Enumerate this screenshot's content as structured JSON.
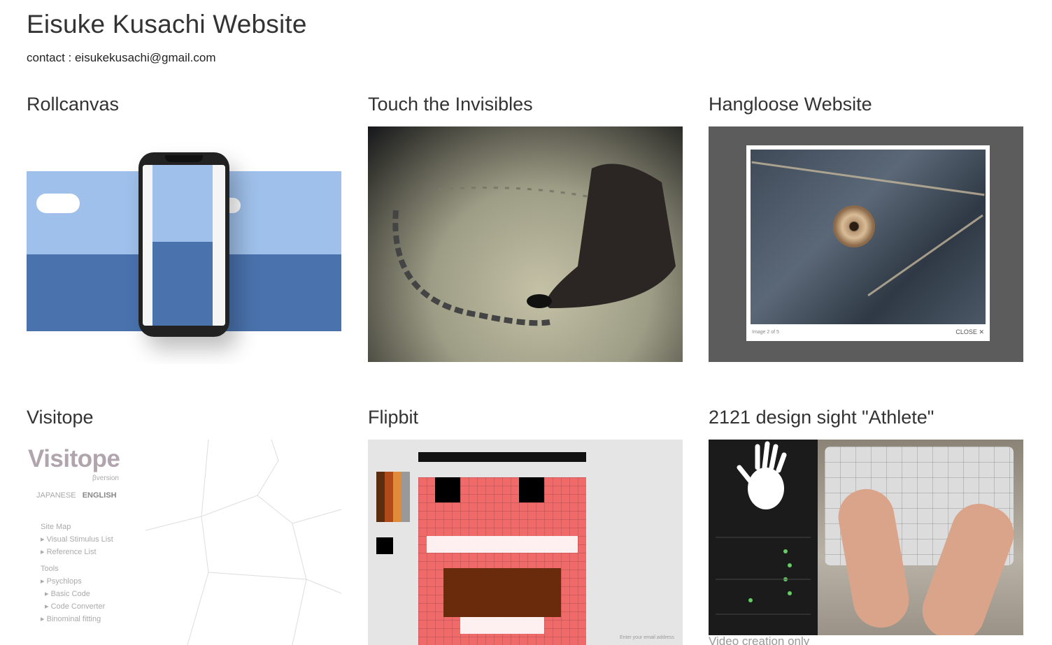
{
  "site": {
    "title": "Eisuke Kusachi Website",
    "contact": "contact : eisukekusachi@gmail.com"
  },
  "works": [
    {
      "title": "Rollcanvas"
    },
    {
      "title": "Touch the Invisibles"
    },
    {
      "title": "Hangloose Website",
      "lightbox_counter": "Image 2 of 5",
      "lightbox_close": "CLOSE"
    },
    {
      "title": "Visitope",
      "logo": "Visitope",
      "version": "βversion",
      "lang_ja": "JAPANESE",
      "lang_en": "ENGLISH",
      "menu": [
        "Site Map",
        "▸ Visual Stimulus List",
        "▸ Reference List",
        "Tools",
        "▸ Psychlops",
        "  ▸ Basic Code",
        "  ▸ Code Converter",
        "▸ Binominal fitting"
      ]
    },
    {
      "title": "Flipbit",
      "email_placeholder": "Enter your email address"
    },
    {
      "title": "2121 design sight \"Athlete\"",
      "caption": "Video creation only"
    }
  ]
}
